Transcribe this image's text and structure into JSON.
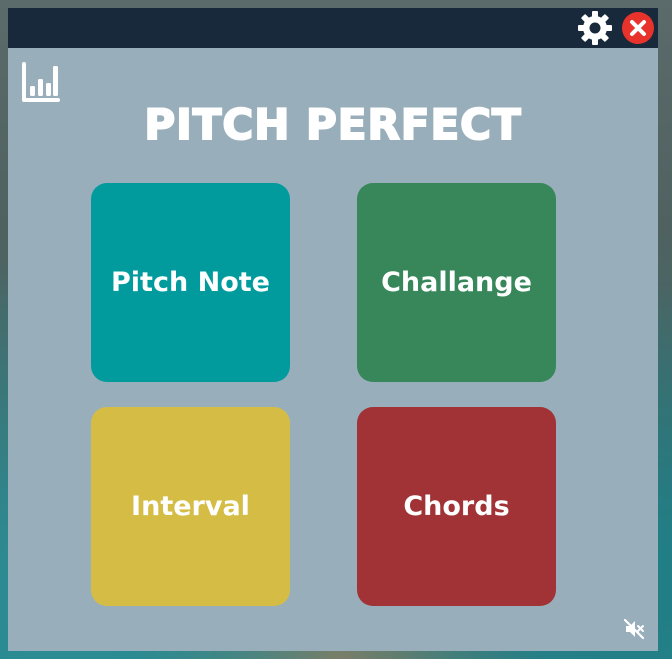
{
  "app": {
    "title": "PITCH PERFECT"
  },
  "titlebar": {
    "settings_icon": "gear-icon",
    "close_icon": "close-icon"
  },
  "toolbar": {
    "stats_icon": "bar-chart-icon",
    "mute_icon": "speaker-muted-icon"
  },
  "modes": [
    {
      "label": "Pitch Note",
      "color": "#019b9e"
    },
    {
      "label": "Challange",
      "color": "#37875a"
    },
    {
      "label": "Interval",
      "color": "#d5bd45"
    },
    {
      "label": "Chords",
      "color": "#a13235"
    }
  ],
  "colors": {
    "window_bg": "#99aebb",
    "titlebar_bg": "#17293a",
    "close_red": "#e8322c"
  }
}
